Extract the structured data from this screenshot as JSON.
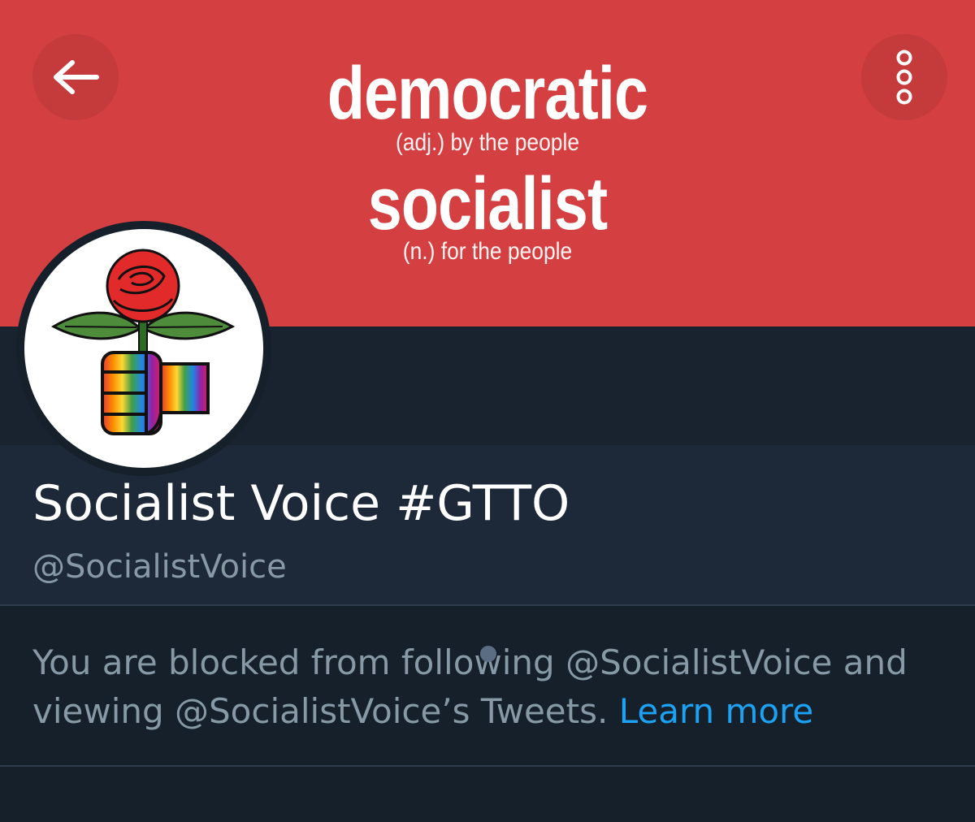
{
  "banner": {
    "word1": "democratic",
    "def1": "(adj.) by the people",
    "word2": "socialist",
    "def2": "(n.) for the people",
    "bg_color": "#d44041"
  },
  "nav": {
    "back_icon": "arrow-left-icon",
    "more_icon": "more-vertical-icon"
  },
  "avatar": {
    "icon": "rose-fist-logo"
  },
  "profile": {
    "display_name": "Socialist Voice #GTTO",
    "handle": "@SocialistVoice"
  },
  "blocked": {
    "message": "You are blocked from following @SocialistVoice and viewing @SocialistVoice’s Tweets.",
    "learn_more": "Learn more",
    "link_color": "#1da1f2"
  }
}
